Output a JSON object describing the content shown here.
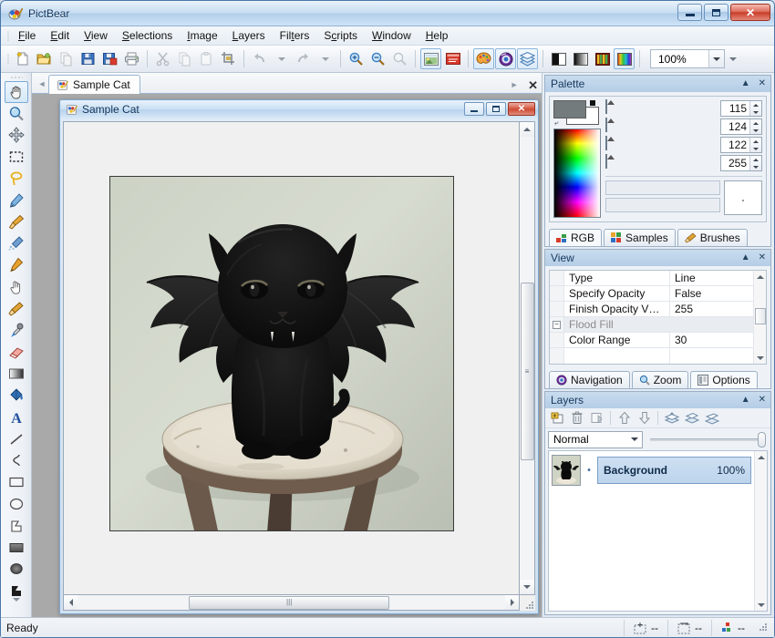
{
  "window": {
    "title": "PictBear",
    "icon": "pictbear-app-icon",
    "controls": {
      "minimize": "Minimize",
      "maximize": "Maximize",
      "close": "Close"
    }
  },
  "menubar": {
    "items": [
      {
        "label": "File",
        "accel": "F"
      },
      {
        "label": "Edit",
        "accel": "E"
      },
      {
        "label": "View",
        "accel": "V"
      },
      {
        "label": "Selections",
        "accel": "S"
      },
      {
        "label": "Image",
        "accel": "I"
      },
      {
        "label": "Layers",
        "accel": "L"
      },
      {
        "label": "Filters",
        "accel": "t"
      },
      {
        "label": "Scripts",
        "accel": "c"
      },
      {
        "label": "Window",
        "accel": "W"
      },
      {
        "label": "Help",
        "accel": "H"
      }
    ]
  },
  "toolbar": {
    "buttons": [
      {
        "name": "new-icon",
        "label": "New"
      },
      {
        "name": "open-folder-icon",
        "label": "Open"
      },
      {
        "name": "copy-document-icon",
        "label": "Duplicate"
      },
      {
        "name": "save-icon",
        "label": "Save"
      },
      {
        "name": "save-as-icon",
        "label": "Save As"
      },
      {
        "name": "print-icon",
        "label": "Print"
      },
      {
        "name": "cut-scissors-icon",
        "label": "Cut"
      },
      {
        "name": "copy-icon",
        "label": "Copy"
      },
      {
        "name": "paste-icon",
        "label": "Paste"
      },
      {
        "name": "crop-icon",
        "label": "Crop"
      },
      {
        "name": "undo-icon",
        "label": "Undo"
      },
      {
        "name": "redo-icon",
        "label": "Redo"
      },
      {
        "name": "zoom-in-icon",
        "label": "Zoom In"
      },
      {
        "name": "zoom-out-icon",
        "label": "Zoom Out"
      },
      {
        "name": "zoom-actual-icon",
        "label": "Actual Size"
      },
      {
        "name": "image-window-icon",
        "label": "Image Window"
      },
      {
        "name": "red-window-icon",
        "label": "Close Window"
      },
      {
        "name": "palette-icon",
        "label": "Palette"
      },
      {
        "name": "navigation-icon",
        "label": "Navigation"
      },
      {
        "name": "layers-stack-icon",
        "label": "Layers"
      },
      {
        "name": "halftone-icon",
        "label": "Halftone"
      },
      {
        "name": "gradient-bw-icon",
        "label": "Gradient"
      },
      {
        "name": "samples-icon",
        "label": "Samples"
      },
      {
        "name": "spectrum-icon",
        "label": "Spectrum"
      }
    ],
    "zoom_value": "100%"
  },
  "tools": {
    "items": [
      {
        "name": "tool-pan-hand",
        "label": "Pan",
        "selected": true
      },
      {
        "name": "tool-magnifier",
        "label": "Zoom",
        "selected": false
      },
      {
        "name": "tool-move",
        "label": "Move",
        "selected": false
      },
      {
        "name": "tool-rect-select",
        "label": "Rectangle Select",
        "selected": false
      },
      {
        "name": "tool-lasso-select",
        "label": "Lasso Select",
        "selected": false
      },
      {
        "name": "tool-pencil",
        "label": "Pencil",
        "selected": false
      },
      {
        "name": "tool-paintbrush",
        "label": "Paint Brush",
        "selected": false
      },
      {
        "name": "tool-airbrush",
        "label": "Air Brush",
        "selected": false
      },
      {
        "name": "tool-marker-pen",
        "label": "Marker",
        "selected": false
      },
      {
        "name": "tool-finger-smudge",
        "label": "Smudge",
        "selected": false
      },
      {
        "name": "tool-blur-brush",
        "label": "Blur",
        "selected": false
      },
      {
        "name": "tool-eyedropper",
        "label": "Color Picker",
        "selected": false
      },
      {
        "name": "tool-eraser",
        "label": "Eraser",
        "selected": false
      },
      {
        "name": "tool-gradient",
        "label": "Gradient",
        "selected": false
      },
      {
        "name": "tool-paint-bucket",
        "label": "Flood Fill",
        "selected": false
      },
      {
        "name": "tool-text",
        "label": "Text",
        "selected": false
      },
      {
        "name": "tool-line",
        "label": "Line",
        "selected": false
      },
      {
        "name": "tool-curve",
        "label": "Curve",
        "selected": false
      },
      {
        "name": "tool-rectangle",
        "label": "Rectangle",
        "selected": false
      },
      {
        "name": "tool-ellipse",
        "label": "Ellipse",
        "selected": false
      },
      {
        "name": "tool-polygon",
        "label": "Polygon",
        "selected": false
      },
      {
        "name": "tool-filled-rect",
        "label": "Filled Rectangle",
        "selected": false
      },
      {
        "name": "tool-filled-ellipse",
        "label": "Filled Ellipse",
        "selected": false
      },
      {
        "name": "tool-filled-polygon",
        "label": "Filled Polygon",
        "selected": false
      }
    ]
  },
  "document": {
    "tab_label": "Sample Cat",
    "tab_icon": "document-icon",
    "close_label": "✕",
    "prev_arrow": "◄",
    "next_arrow": "►",
    "child_window": {
      "title": "Sample Cat",
      "icon": "document-icon"
    },
    "image_alt": "black kitten wearing bat wings sitting on a white stool"
  },
  "palette_panel": {
    "title": "Palette",
    "collapse_label": "▲",
    "close_label": "✕",
    "foreground_color": "#737b7d",
    "background_color": "#ffffff",
    "channels": [
      {
        "name": "red",
        "value": "115"
      },
      {
        "name": "green",
        "value": "124"
      },
      {
        "name": "blue",
        "value": "122"
      },
      {
        "name": "alpha",
        "value": "255"
      }
    ],
    "tabs": [
      {
        "label": "RGB",
        "icon": "rgb-icon",
        "active": true
      },
      {
        "label": "Samples",
        "icon": "samples-icon",
        "active": false
      },
      {
        "label": "Brushes",
        "icon": "brush-icon",
        "active": false
      }
    ]
  },
  "view_panel": {
    "title": "View",
    "collapse_label": "▲",
    "close_label": "✕",
    "properties": [
      {
        "name": "Type",
        "value": "Line",
        "group": false
      },
      {
        "name": "Specify Opacity",
        "value": "False",
        "group": false
      },
      {
        "name": "Finish Opacity V…",
        "value": "255",
        "group": false
      },
      {
        "name": "Flood Fill",
        "value": "",
        "group": true
      },
      {
        "name": "Color Range",
        "value": "30",
        "group": false
      }
    ],
    "tabs": [
      {
        "label": "Navigation",
        "icon": "navigation-icon",
        "active": false
      },
      {
        "label": "Zoom",
        "icon": "magnifier-icon",
        "active": false
      },
      {
        "label": "Options",
        "icon": "options-icon",
        "active": true
      }
    ]
  },
  "layers_panel": {
    "title": "Layers",
    "collapse_label": "▲",
    "close_label": "✕",
    "toolbar_buttons": [
      {
        "name": "add-layer-icon",
        "label": "New Layer"
      },
      {
        "name": "delete-layer-icon",
        "label": "Delete Layer"
      },
      {
        "name": "layer-properties-icon",
        "label": "Layer Properties"
      },
      {
        "name": "move-layer-up-icon",
        "label": "Move Up"
      },
      {
        "name": "move-layer-down-icon",
        "label": "Move Down"
      },
      {
        "name": "merge-down-icon",
        "label": "Merge Down"
      },
      {
        "name": "merge-visible-icon",
        "label": "Merge Visible"
      },
      {
        "name": "flatten-icon",
        "label": "Flatten Image"
      }
    ],
    "blend_mode": "Normal",
    "opacity_percent": 100,
    "layers": [
      {
        "name": "Background",
        "opacity": "100%",
        "visible": true,
        "selected": true
      }
    ]
  },
  "statusbar": {
    "message": "Ready",
    "cells": [
      {
        "icon": "cursor-position-icon",
        "value": "--"
      },
      {
        "icon": "selection-size-icon",
        "value": "--"
      },
      {
        "icon": "color-value-icon",
        "value": "--"
      }
    ]
  },
  "colors": {
    "accent": "#4a77a8",
    "panel_header": "#b4cde6",
    "selection_blue": "#bcd4ec",
    "workspace_gray": "#a9a9a9",
    "close_red": "#c93d29"
  }
}
